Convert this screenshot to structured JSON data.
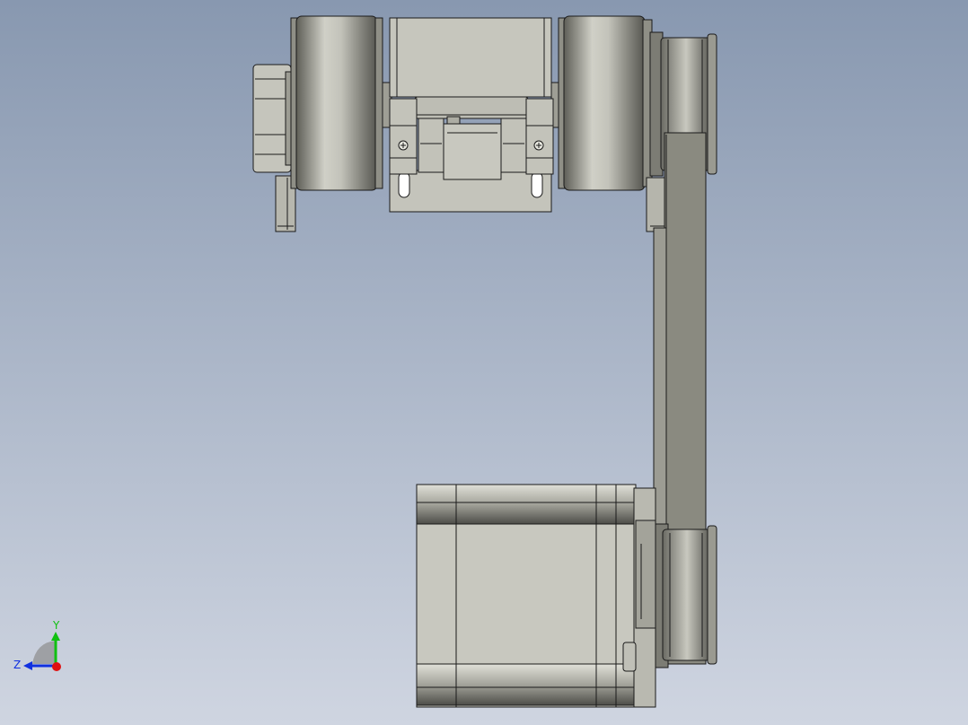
{
  "viewport": {
    "background_top": "#8898b0",
    "background_bottom": "#cfd5e1"
  },
  "colors": {
    "outline": "#1a1a1a",
    "part_light": "#c8c8bf",
    "part_mid": "#a9a99f",
    "part_dark": "#6f6f68",
    "belt": "#8a8a80",
    "x_axis": "#e01010",
    "y_axis": "#10c010",
    "z_axis": "#1030e0"
  },
  "triad": {
    "y_label": "Y",
    "z_label": "Z",
    "icon": "axis-triad-icon"
  }
}
